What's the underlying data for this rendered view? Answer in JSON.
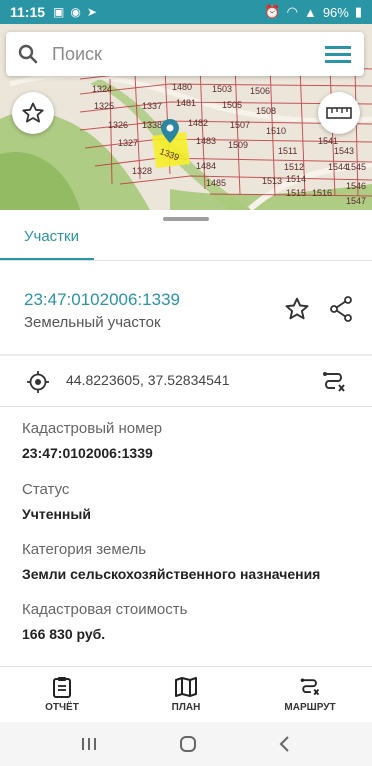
{
  "status_bar": {
    "time": "11:15",
    "battery": "96%"
  },
  "search": {
    "placeholder": "Поиск"
  },
  "map": {
    "parcel_labels": [
      "1324",
      "1325",
      "1326",
      "1327",
      "1328",
      "1337",
      "1338",
      "1339",
      "1340",
      "1480",
      "1481",
      "1482",
      "1483",
      "1484",
      "1485",
      "1503",
      "1505",
      "1506",
      "1507",
      "1508",
      "1509",
      "1510",
      "1511",
      "1512",
      "1513",
      "1514",
      "1515",
      "1516",
      "1541",
      "1542",
      "1543",
      "1544",
      "1545",
      "1546",
      "1547"
    ]
  },
  "sheet": {
    "tab_label": "Участки",
    "parcel_number": "23:47:0102006:1339",
    "parcel_type": "Земельный участок",
    "coordinates": "44.8223605, 37.52834541",
    "fields": [
      {
        "label": "Кадастровый номер",
        "value": "23:47:0102006:1339"
      },
      {
        "label": "Статус",
        "value": "Учтенный"
      },
      {
        "label": "Категория земель",
        "value": "Земли сельскохозяйственного назначения"
      },
      {
        "label": "Кадастровая стоимость",
        "value": "166 830 руб."
      }
    ]
  },
  "bottom_nav": {
    "report": "ОТЧЁТ",
    "plan": "ПЛАН",
    "route": "МАРШРУТ"
  },
  "colors": {
    "accent": "#2a95a5",
    "parcel_line": "#c0393f",
    "vegetation": "#a8c97a"
  }
}
